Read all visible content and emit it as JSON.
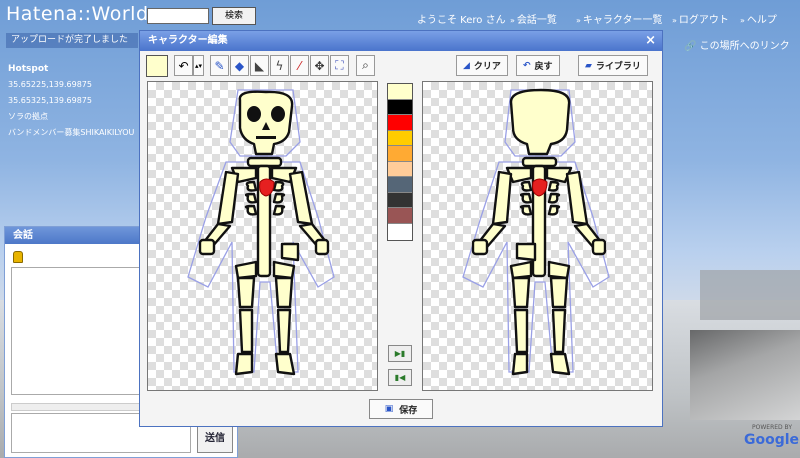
{
  "topbar": {
    "logo": "Hatena::World",
    "search_button": "検索",
    "welcome": "ようこそ Kero さん",
    "nav": [
      "会話一覧",
      "キャラクター一覧",
      "ログアウト",
      "ヘルプ"
    ]
  },
  "notice": "アップロードが完了しました",
  "side_info": {
    "heading": "Hotspot",
    "lines": [
      "35.65225,139.69875",
      "35.65325,139.69875",
      "ソラの拠点",
      "バンドメンバー募集SHIKAIKILYOU"
    ]
  },
  "link_here": "この場所へのリンク",
  "chat": {
    "title": "会話",
    "send_label": "送信"
  },
  "dialog": {
    "title": "キャラクター編集",
    "close": "×",
    "clear_label": "クリア",
    "undo_label": "戻す",
    "library_label": "ライブラリ",
    "save_label": "保存"
  },
  "palette": [
    "#ffffcc",
    "#000000",
    "#ff0000",
    "#ffcc00",
    "#ffaa33",
    "#ffcc99",
    "#556677",
    "#333333",
    "#995555",
    "#ffffff"
  ],
  "map": {
    "attribution": "POWERED BY",
    "brand": "Google"
  }
}
